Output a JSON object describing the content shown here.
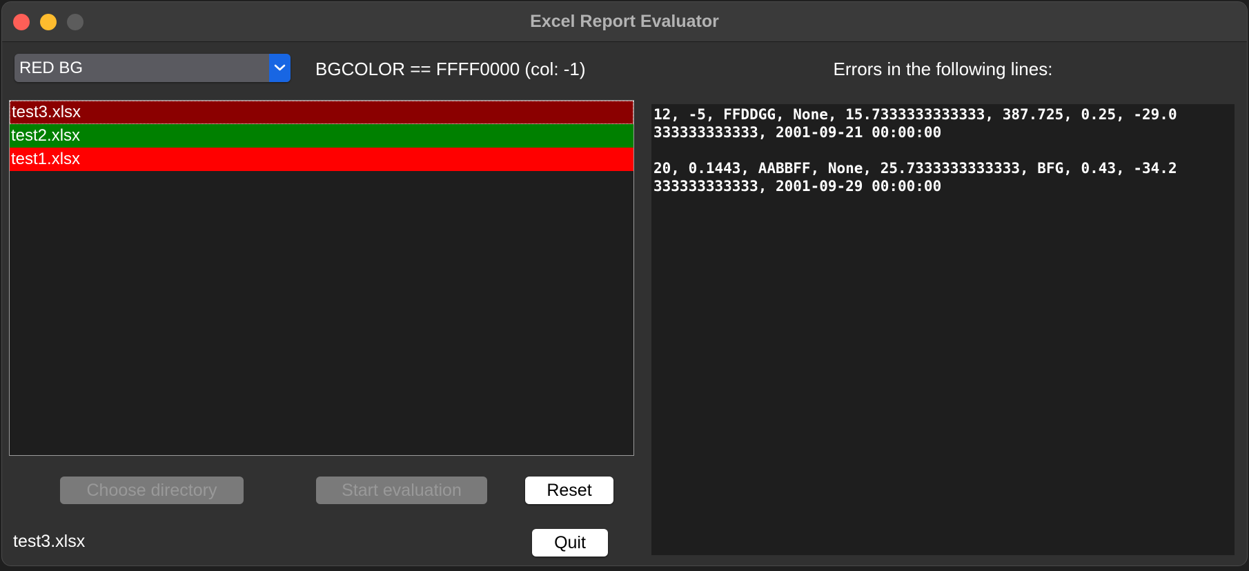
{
  "window": {
    "title": "Excel Report Evaluator"
  },
  "rule_selector": {
    "selected": "RED BG",
    "arrow_icon": "chevron-down-icon"
  },
  "rule_description": "BGCOLOR == FFFF0000 (col: -1)",
  "errors": {
    "heading": "Errors in the following lines:",
    "lines": [
      "12, -5, FFDDGG, None, 15.7333333333333, 387.725, 0.25, -29.0\n333333333333, 2001-09-21 00:00:00",
      "20, 0.1443, AABBFF, None, 25.7333333333333, BFG, 0.43, -34.2\n333333333333, 2001-09-29 00:00:00"
    ]
  },
  "files": [
    {
      "name": "test3.xlsx",
      "status_color": "#8b0000",
      "selected": true
    },
    {
      "name": "test2.xlsx",
      "status_color": "#008000",
      "selected": false
    },
    {
      "name": "test1.xlsx",
      "status_color": "#ff0000",
      "selected": false
    }
  ],
  "buttons": {
    "choose_directory": "Choose directory",
    "start_evaluation": "Start evaluation",
    "reset": "Reset",
    "quit": "Quit"
  },
  "status": {
    "current_file": "test3.xlsx"
  },
  "colors": {
    "close": "#fe5f57",
    "minimize": "#febc2e",
    "zoom_disabled": "#5c5c5c",
    "accent": "#1866e3"
  }
}
